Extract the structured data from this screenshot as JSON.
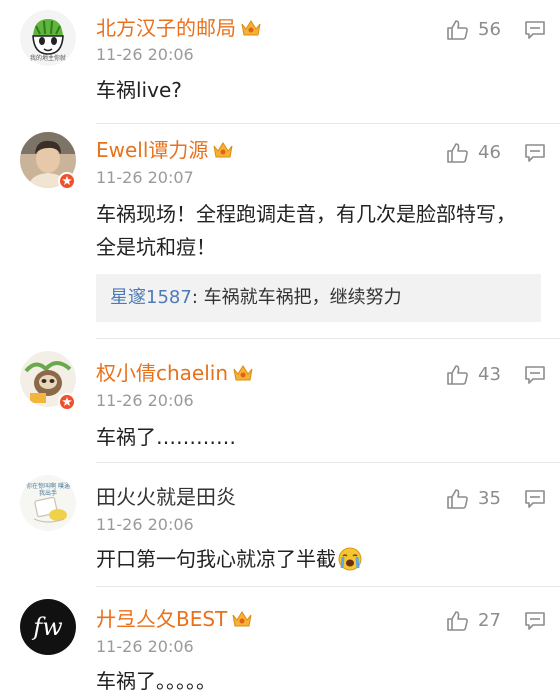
{
  "comments": [
    {
      "username": "北方汉子的邮局",
      "time": "11-26 20:06",
      "text": "车祸live?",
      "likes": "56",
      "avatar_caption": "我的地主你就"
    },
    {
      "username": "Ewell谭力源",
      "time": "11-26 20:07",
      "text": "车祸现场！全程跑调走音，有几次是脸部特写，全是坑和痘！",
      "likes": "46",
      "reply": {
        "author": "星邃1587",
        "separator": ": ",
        "text": "车祸就车祸把，继续努力"
      }
    },
    {
      "username": "权小倩chaelin",
      "time": "11-26 20:06",
      "text": "车祸了…………",
      "likes": "43"
    },
    {
      "username": "田火火就是田炎",
      "time": "11-26 20:06",
      "text": "开口第一句我心就凉了半截",
      "likes": "35",
      "avatar_caption": "你在惊叫啊 噗通我出手"
    },
    {
      "username": "廾弖亼夂BEST",
      "time": "11-26 20:06",
      "text": "车祸了。。。。。",
      "likes": "27",
      "avatar_caption": "fw"
    }
  ],
  "colors": {
    "vip_name": "#e9711c",
    "plain_name": "#333333",
    "reply_author": "#4e7bb7",
    "time": "#9a9a9a",
    "verified_badge": "#f0512b"
  },
  "icons": {
    "like": "thumbs-up-icon",
    "reply": "comment-bubble-icon",
    "vip": "vip-crown-icon",
    "emoji": "crying-face-emoji"
  }
}
